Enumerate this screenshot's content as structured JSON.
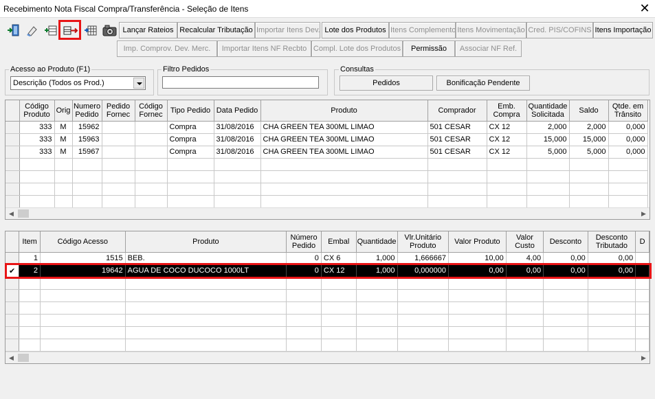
{
  "window": {
    "title": "Recebimento Nota Fiscal Compra/Transferência - Seleção de Itens",
    "close_glyph": "✕"
  },
  "toolbar": {
    "icons": [
      {
        "name": "exit-door-icon"
      },
      {
        "name": "eraser-icon"
      },
      {
        "name": "insert-row-icon"
      },
      {
        "name": "import-items-icon"
      },
      {
        "name": "grid-edit-icon"
      },
      {
        "name": "camera-icon"
      }
    ],
    "row1": [
      {
        "label": "Lançar Rateios",
        "enabled": true
      },
      {
        "label": "Recalcular Tributação",
        "enabled": true
      },
      {
        "label": "Importar Itens Dev.",
        "enabled": false
      },
      {
        "label": "Lote dos Produtos",
        "enabled": true
      },
      {
        "label": "Itens Complemento",
        "enabled": false
      },
      {
        "label": "Itens Movimentação",
        "enabled": false
      },
      {
        "label": "Cred. PIS/COFINS",
        "enabled": false
      },
      {
        "label": "Itens Importação",
        "enabled": true
      }
    ],
    "row2": [
      {
        "label": "Imp. Comprov. Dev. Merc.",
        "enabled": false
      },
      {
        "label": "Importar Itens NF Recbto",
        "enabled": false
      },
      {
        "label": "Compl. Lote dos Produtos",
        "enabled": false
      },
      {
        "label": "Permissão",
        "enabled": true
      },
      {
        "label": "Associar NF Ref.",
        "enabled": false
      }
    ]
  },
  "filters": {
    "acesso_label": "Acesso ao Produto (F1)",
    "acesso_value": "Descrição (Todos os Prod.)",
    "filtro_label": "Filtro Pedidos",
    "filtro_value": "",
    "consultas_label": "Consultas",
    "pedidos_button": "Pedidos",
    "bonificacao_button": "Bonificação Pendente"
  },
  "orders_grid": {
    "columns": [
      "Código Produto",
      "Orig",
      "Numero Pedido",
      "Pedido Fornec",
      "Código Fornec",
      "Tipo Pedido",
      "Data Pedido",
      "Produto",
      "Comprador",
      "Emb. Compra",
      "Quantidade Solicitada",
      "Saldo",
      "Qtde. em Trânsito"
    ],
    "rows": [
      [
        "333",
        "M",
        "15962",
        "",
        "",
        "Compra",
        "31/08/2016",
        "CHA GREEN TEA 300ML LIMAO",
        "501 CESAR",
        "CX  12",
        "2,000",
        "2,000",
        "0,000"
      ],
      [
        "333",
        "M",
        "15963",
        "",
        "",
        "Compra",
        "31/08/2016",
        "CHA GREEN TEA 300ML LIMAO",
        "501 CESAR",
        "CX  12",
        "15,000",
        "15,000",
        "0,000"
      ],
      [
        "333",
        "M",
        "15967",
        "",
        "",
        "Compra",
        "31/08/2016",
        "CHA GREEN TEA 300ML LIMAO",
        "501 CESAR",
        "CX  12",
        "5,000",
        "5,000",
        "0,000"
      ]
    ]
  },
  "items_grid": {
    "columns": [
      "Item",
      "Código Acesso",
      "Produto",
      "Número Pedido",
      "Embal",
      "Quantidade",
      "Vlr.Unitário Produto",
      "Valor Produto",
      "Valor Custo",
      "Desconto",
      "Desconto Tributado",
      "D"
    ],
    "rows": [
      {
        "selected": false,
        "mark": "",
        "cells": [
          "1",
          "1515",
          "BEB.",
          "0",
          "CX  6",
          "1,000",
          "1,666667",
          "10,00",
          "4,00",
          "0,00",
          "0,00",
          ""
        ]
      },
      {
        "selected": true,
        "mark": "✔",
        "cells": [
          "2",
          "19642",
          "AGUA DE COCO DUCOCO 1000LT",
          "0",
          "CX  12",
          "1,000",
          "0,000000",
          "0,00",
          "0,00",
          "0,00",
          "0,00",
          ""
        ]
      }
    ]
  },
  "scrollbars": {
    "left_arrow": "◀",
    "right_arrow": "▶"
  },
  "colors": {
    "highlight": "#e81416",
    "selected_row": "#000000"
  }
}
